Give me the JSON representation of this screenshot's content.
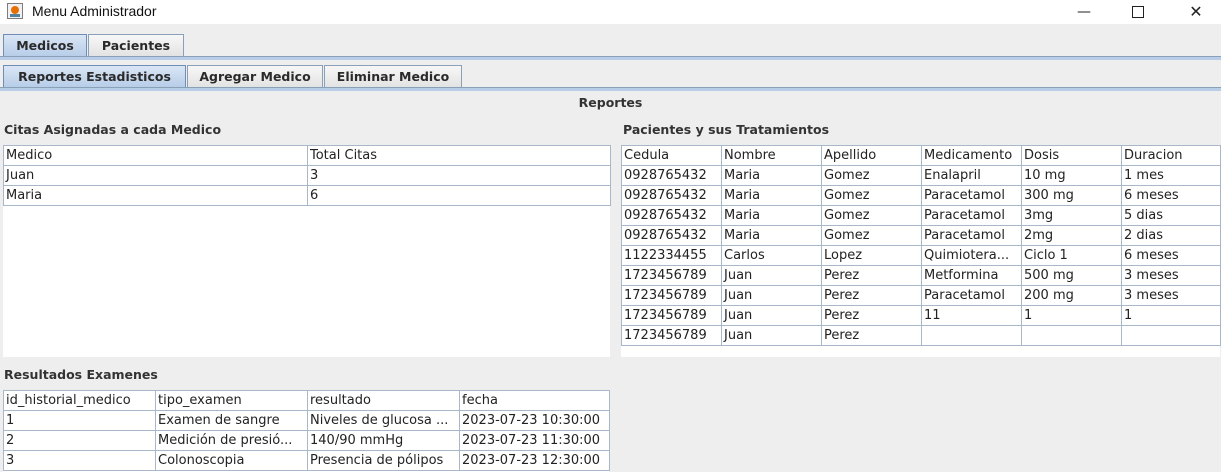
{
  "window": {
    "title": "Menu Administrador",
    "minimize": "—",
    "close": "✕"
  },
  "main_tabs": [
    "Medicos",
    "Pacientes"
  ],
  "sub_tabs": [
    "Reportes Estadisticos",
    "Agregar Medico",
    "Eliminar Medico"
  ],
  "reports": {
    "title": "Reportes",
    "citas": {
      "title": "Citas Asignadas a cada Medico",
      "columns": [
        "Medico",
        "Total Citas"
      ],
      "rows": [
        [
          "Juan",
          "3"
        ],
        [
          "Maria",
          "6"
        ]
      ]
    },
    "pacientes": {
      "title": "Pacientes y sus Tratamientos",
      "columns": [
        "Cedula",
        "Nombre",
        "Apellido",
        "Medicamento",
        "Dosis",
        "Duracion"
      ],
      "rows": [
        [
          "0928765432",
          "Maria",
          "Gomez",
          "Enalapril",
          "10 mg",
          "1 mes"
        ],
        [
          "0928765432",
          "Maria",
          "Gomez",
          "Paracetamol",
          "300 mg",
          "6 meses"
        ],
        [
          "0928765432",
          "Maria",
          "Gomez",
          "Paracetamol",
          "3mg",
          "5 dias"
        ],
        [
          "0928765432",
          "Maria",
          "Gomez",
          "Paracetamol",
          "2mg",
          "2 dias"
        ],
        [
          "1122334455",
          "Carlos",
          "Lopez",
          "Quimiotera...",
          "Ciclo 1",
          "6 meses"
        ],
        [
          "1723456789",
          "Juan",
          "Perez",
          "Metformina",
          "500 mg",
          "3 meses"
        ],
        [
          "1723456789",
          "Juan",
          "Perez",
          "Paracetamol",
          "200 mg",
          "3 meses"
        ],
        [
          "1723456789",
          "Juan",
          "Perez",
          "11",
          "1",
          "1"
        ],
        [
          "1723456789",
          "Juan",
          "Perez",
          "",
          "",
          ""
        ]
      ]
    },
    "examenes": {
      "title": "Resultados Examenes",
      "columns": [
        "id_historial_medico",
        "tipo_examen",
        "resultado",
        "fecha"
      ],
      "rows": [
        [
          "1",
          "Examen de sangre",
          "Niveles de glucosa ...",
          "2023-07-23 10:30:00"
        ],
        [
          "2",
          "Medición de presió...",
          "140/90 mmHg",
          "2023-07-23 11:30:00"
        ],
        [
          "3",
          "Colonoscopia",
          "Presencia de pólipos",
          "2023-07-23 12:30:00"
        ]
      ]
    }
  }
}
